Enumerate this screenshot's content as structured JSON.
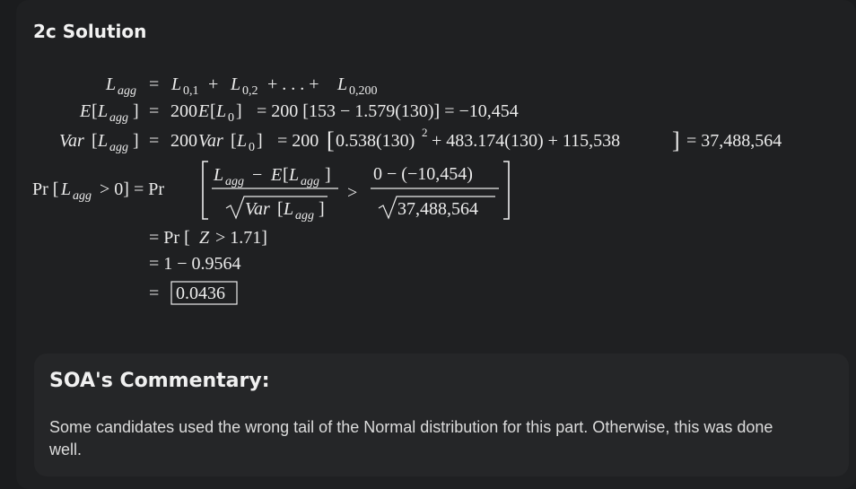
{
  "section_title": "2c Solution",
  "equations": {
    "line1": {
      "lhs": "L",
      "lhs_sub": "agg",
      "rhs": "= L0,1 + L0,2 + . . . + L0,200"
    },
    "line2": {
      "lhs": "E[Lagg]",
      "rhs": "= 200E[L0] = 200 [153 − 1.579(130)] = −10,454"
    },
    "line3": {
      "lhs": "Var[Lagg]",
      "rhs": "= 200Var[L0] = 200 [0.538(130)² + 483.174(130) + 115,538] = 37,488,564"
    },
    "line4": {
      "lhs": "Pr [Lagg > 0] = Pr",
      "frac1_num": "Lagg − E[Lagg]",
      "frac1_den": "√Var[Lagg]",
      "relation": ">",
      "frac2_num": "0 − (−10,454)",
      "frac2_den": "√37,488,564"
    },
    "line5": "= Pr [Z > 1.71]",
    "line6": "= 1 − 0.9564",
    "line7_eq": "=",
    "line7_boxed": "0.0436"
  },
  "commentary": {
    "heading": "SOA's Commentary:",
    "text": "Some candidates used the wrong tail of the Normal distribution for this part. Otherwise, this was done well."
  }
}
